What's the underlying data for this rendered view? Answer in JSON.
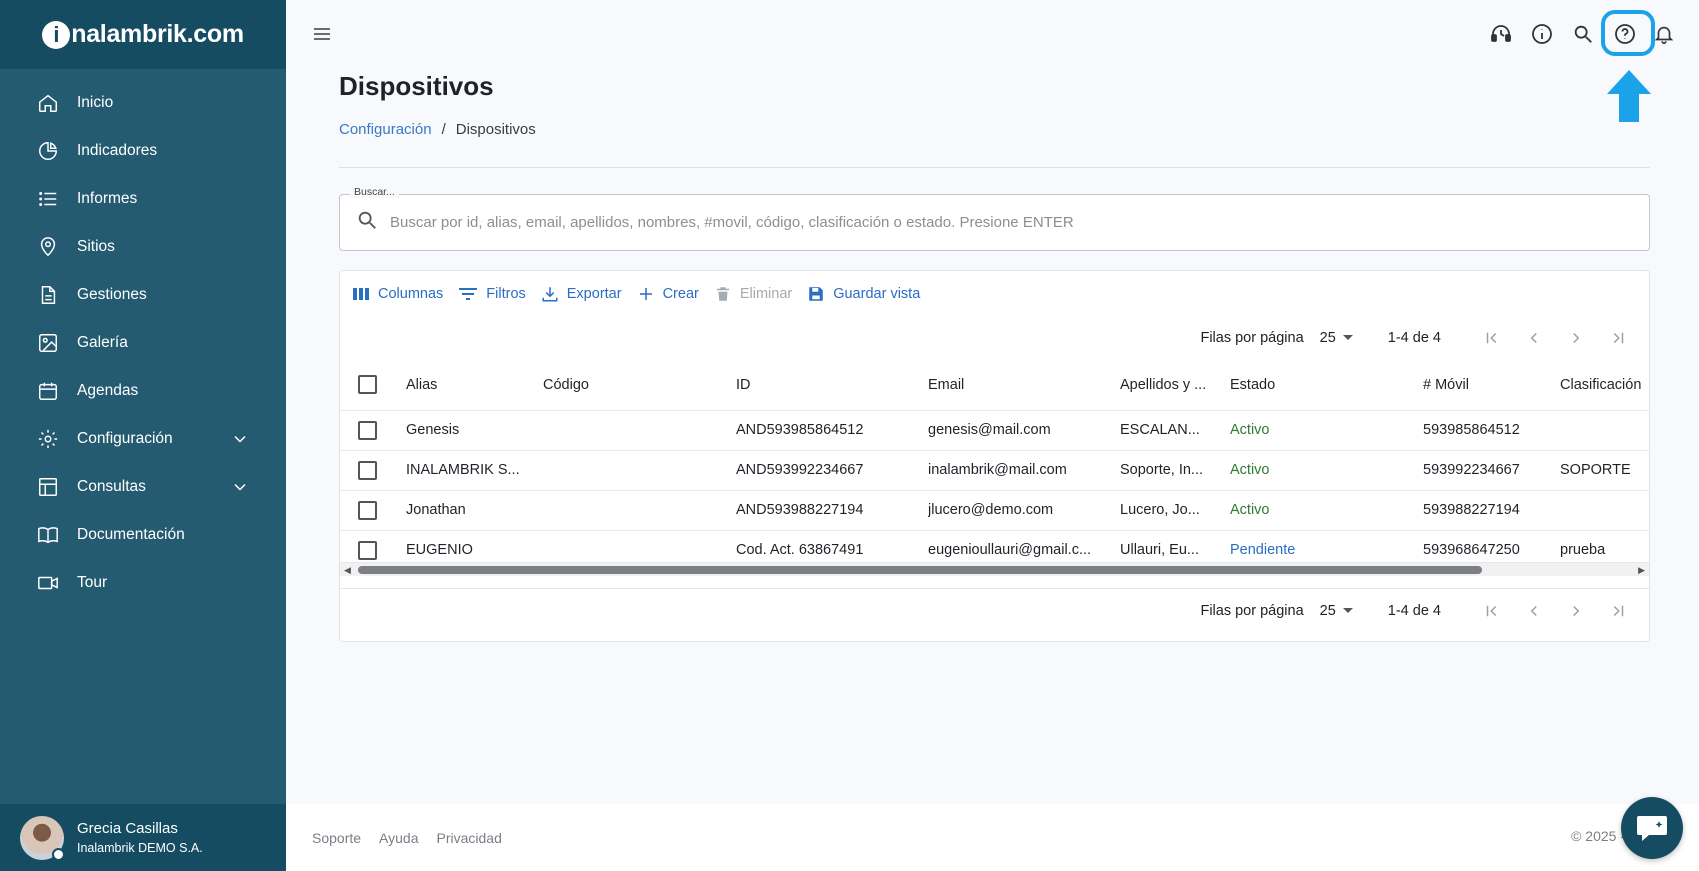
{
  "brand": {
    "logo_text": "nalambrik.com",
    "logo_letter": "i"
  },
  "sidebar": {
    "items": [
      {
        "label": "Inicio",
        "icon": "home-icon"
      },
      {
        "label": "Indicadores",
        "icon": "pie-chart-icon"
      },
      {
        "label": "Informes",
        "icon": "list-icon"
      },
      {
        "label": "Sitios",
        "icon": "location-pin-icon"
      },
      {
        "label": "Gestiones",
        "icon": "document-icon"
      },
      {
        "label": "Galería",
        "icon": "image-icon"
      },
      {
        "label": "Agendas",
        "icon": "calendar-icon"
      },
      {
        "label": "Configuración",
        "icon": "gear-icon",
        "expandable": true
      },
      {
        "label": "Consultas",
        "icon": "table-icon",
        "expandable": true
      },
      {
        "label": "Documentación",
        "icon": "book-icon"
      },
      {
        "label": "Tour",
        "icon": "video-icon"
      }
    ],
    "user": {
      "name": "Grecia Casillas",
      "org": "Inalambrik DEMO S.A."
    }
  },
  "topbar": {
    "icons": [
      "menu-icon",
      "support-agent-icon",
      "info-icon",
      "search-icon",
      "help-icon",
      "bell-icon"
    ]
  },
  "page": {
    "title": "Dispositivos",
    "breadcrumb": {
      "parent": "Configuración",
      "separator": "/",
      "current": "Dispositivos"
    }
  },
  "search": {
    "label": "Buscar...",
    "placeholder": "Buscar por id, alias, email, apellidos, nombres, #movil, código, clasificación o estado. Presione ENTER",
    "value": ""
  },
  "toolbar": {
    "columns": "Columnas",
    "filters": "Filtros",
    "export": "Exportar",
    "create": "Crear",
    "delete": "Eliminar",
    "save_view": "Guardar vista"
  },
  "pagination": {
    "rows_label": "Filas por página",
    "rows_per_page": "25",
    "range": "1-4 de 4"
  },
  "table": {
    "headers": [
      "Alias",
      "Código",
      "ID",
      "Email",
      "Apellidos y ...",
      "Estado",
      "# Móvil",
      "Clasificación"
    ],
    "rows": [
      [
        "Genesis",
        "",
        "AND593985864512",
        "genesis@mail.com",
        "ESCALAN...",
        "Activo",
        "593985864512",
        ""
      ],
      [
        "INALAMBRIK S...",
        "",
        "AND593992234667",
        "inalambrik@mail.com",
        "Soporte, In...",
        "Activo",
        "593992234667",
        "SOPORTE"
      ],
      [
        "Jonathan",
        "",
        "AND593988227194",
        "jlucero@demo.com",
        "Lucero, Jo...",
        "Activo",
        "593988227194",
        ""
      ],
      [
        "EUGENIO",
        "",
        "Cod. Act. 63867491",
        "eugenioullauri@gmail.c...",
        "Ullauri, Eu...",
        "Pendiente",
        "593968647250",
        "prueba"
      ]
    ]
  },
  "footer": {
    "links": [
      "Soporte",
      "Ayuda",
      "Privacidad"
    ],
    "copyright": "© 2025 -"
  },
  "colors": {
    "sidebar": "#245b70",
    "sidebar_dark": "#154c62",
    "accent": "#2b6cc4",
    "active": "#2e7d32",
    "highlight": "#1aa3e8"
  }
}
